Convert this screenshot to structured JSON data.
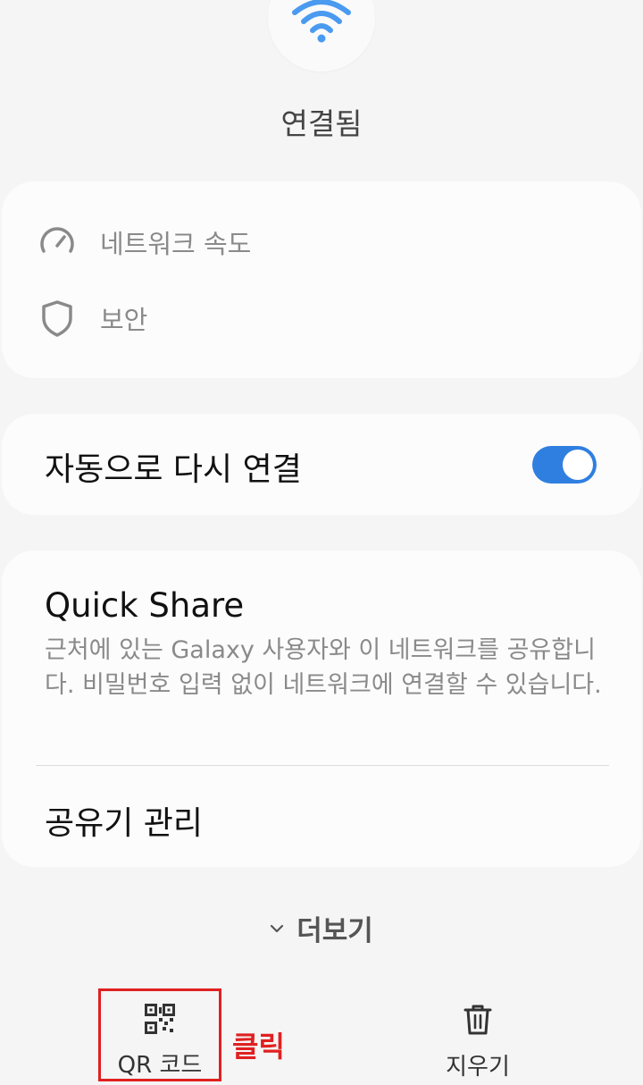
{
  "status": {
    "title": "연결됨",
    "wifi_icon": "wifi-icon",
    "accent_color": "#4a9af0"
  },
  "info_card": {
    "items": [
      {
        "icon": "speedometer-icon",
        "label": "네트워크 속도"
      },
      {
        "icon": "shield-icon",
        "label": "보안"
      }
    ]
  },
  "auto_reconnect": {
    "label": "자동으로 다시 연결",
    "enabled": true,
    "toggle_color": "#2f7fe0"
  },
  "share_card": {
    "title": "Quick Share",
    "description": "근처에 있는 Galaxy 사용자와 이 네트워크를 공유합니다. 비밀번호 입력 없이 네트워크에 연결할 수 있습니다.",
    "router_label": "공유기 관리"
  },
  "more": {
    "label": "더보기",
    "icon": "chevron-down-icon"
  },
  "bottom_bar": {
    "qr_label": "QR 코드",
    "qr_icon": "qr-code-icon",
    "delete_label": "지우기",
    "delete_icon": "trash-icon"
  },
  "annotation": {
    "text": "클릭",
    "color": "#e02020"
  }
}
